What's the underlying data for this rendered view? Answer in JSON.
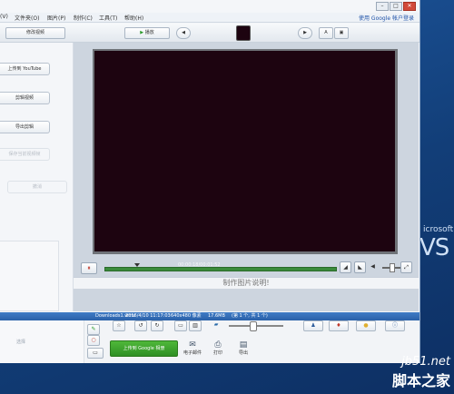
{
  "menu": {
    "items": [
      "(V)",
      "文件夹(O)",
      "图片(P)",
      "制作(C)",
      "工具(T)",
      "帮助(H)"
    ],
    "account_link": "使用 Google 帐户登录"
  },
  "window_controls": {
    "minimize": "–",
    "maximize": "□",
    "close": "✕"
  },
  "toolbar": {
    "back_library": "修改视频",
    "play": "播放",
    "play_glyph": "▶",
    "prev": "◀",
    "next": "▶",
    "view_a": "A",
    "view_b": "▣"
  },
  "sidebar": {
    "buttons": [
      {
        "label": "上传到 YouTube",
        "disabled": false
      },
      {
        "label": "剪辑视频",
        "disabled": false
      },
      {
        "label": "导出剪辑",
        "disabled": false
      },
      {
        "label": "保存当前视频帧",
        "disabled": true
      },
      {
        "label": "撤消",
        "disabled": true
      }
    ],
    "select_label": "选择"
  },
  "player": {
    "timestamp": "00:00:18/00:01:52",
    "pause_glyph": "⏸",
    "caption_text": "制作图片说明!",
    "caption_left": "‖",
    "playback_fraction": 0.14,
    "volume_fraction": 0.4
  },
  "infobar": {
    "filename": "Downloads1.wmv",
    "datetime": "2016/4/10 11:17:03",
    "resolution": "640x480 像素",
    "size": "17.6MB",
    "position": "(第 1 个, 共 1 个)"
  },
  "bottom": {
    "upload_google": "上传到 Google 相册",
    "email": "电子邮件",
    "print": "打印",
    "export": "导出",
    "icons": [
      "pencil-icon",
      "redeye-icon",
      "star-icon",
      "rotate-left-icon",
      "rotate-right-icon",
      "person-icon",
      "pin-icon",
      "tag-icon",
      "info-icon"
    ],
    "zoom_fraction": 0.43
  },
  "desktop": {
    "brand_small": "icrosoft",
    "brand_large": "VS"
  },
  "watermark": {
    "url": "jb51.net",
    "site": "脚本之家"
  }
}
